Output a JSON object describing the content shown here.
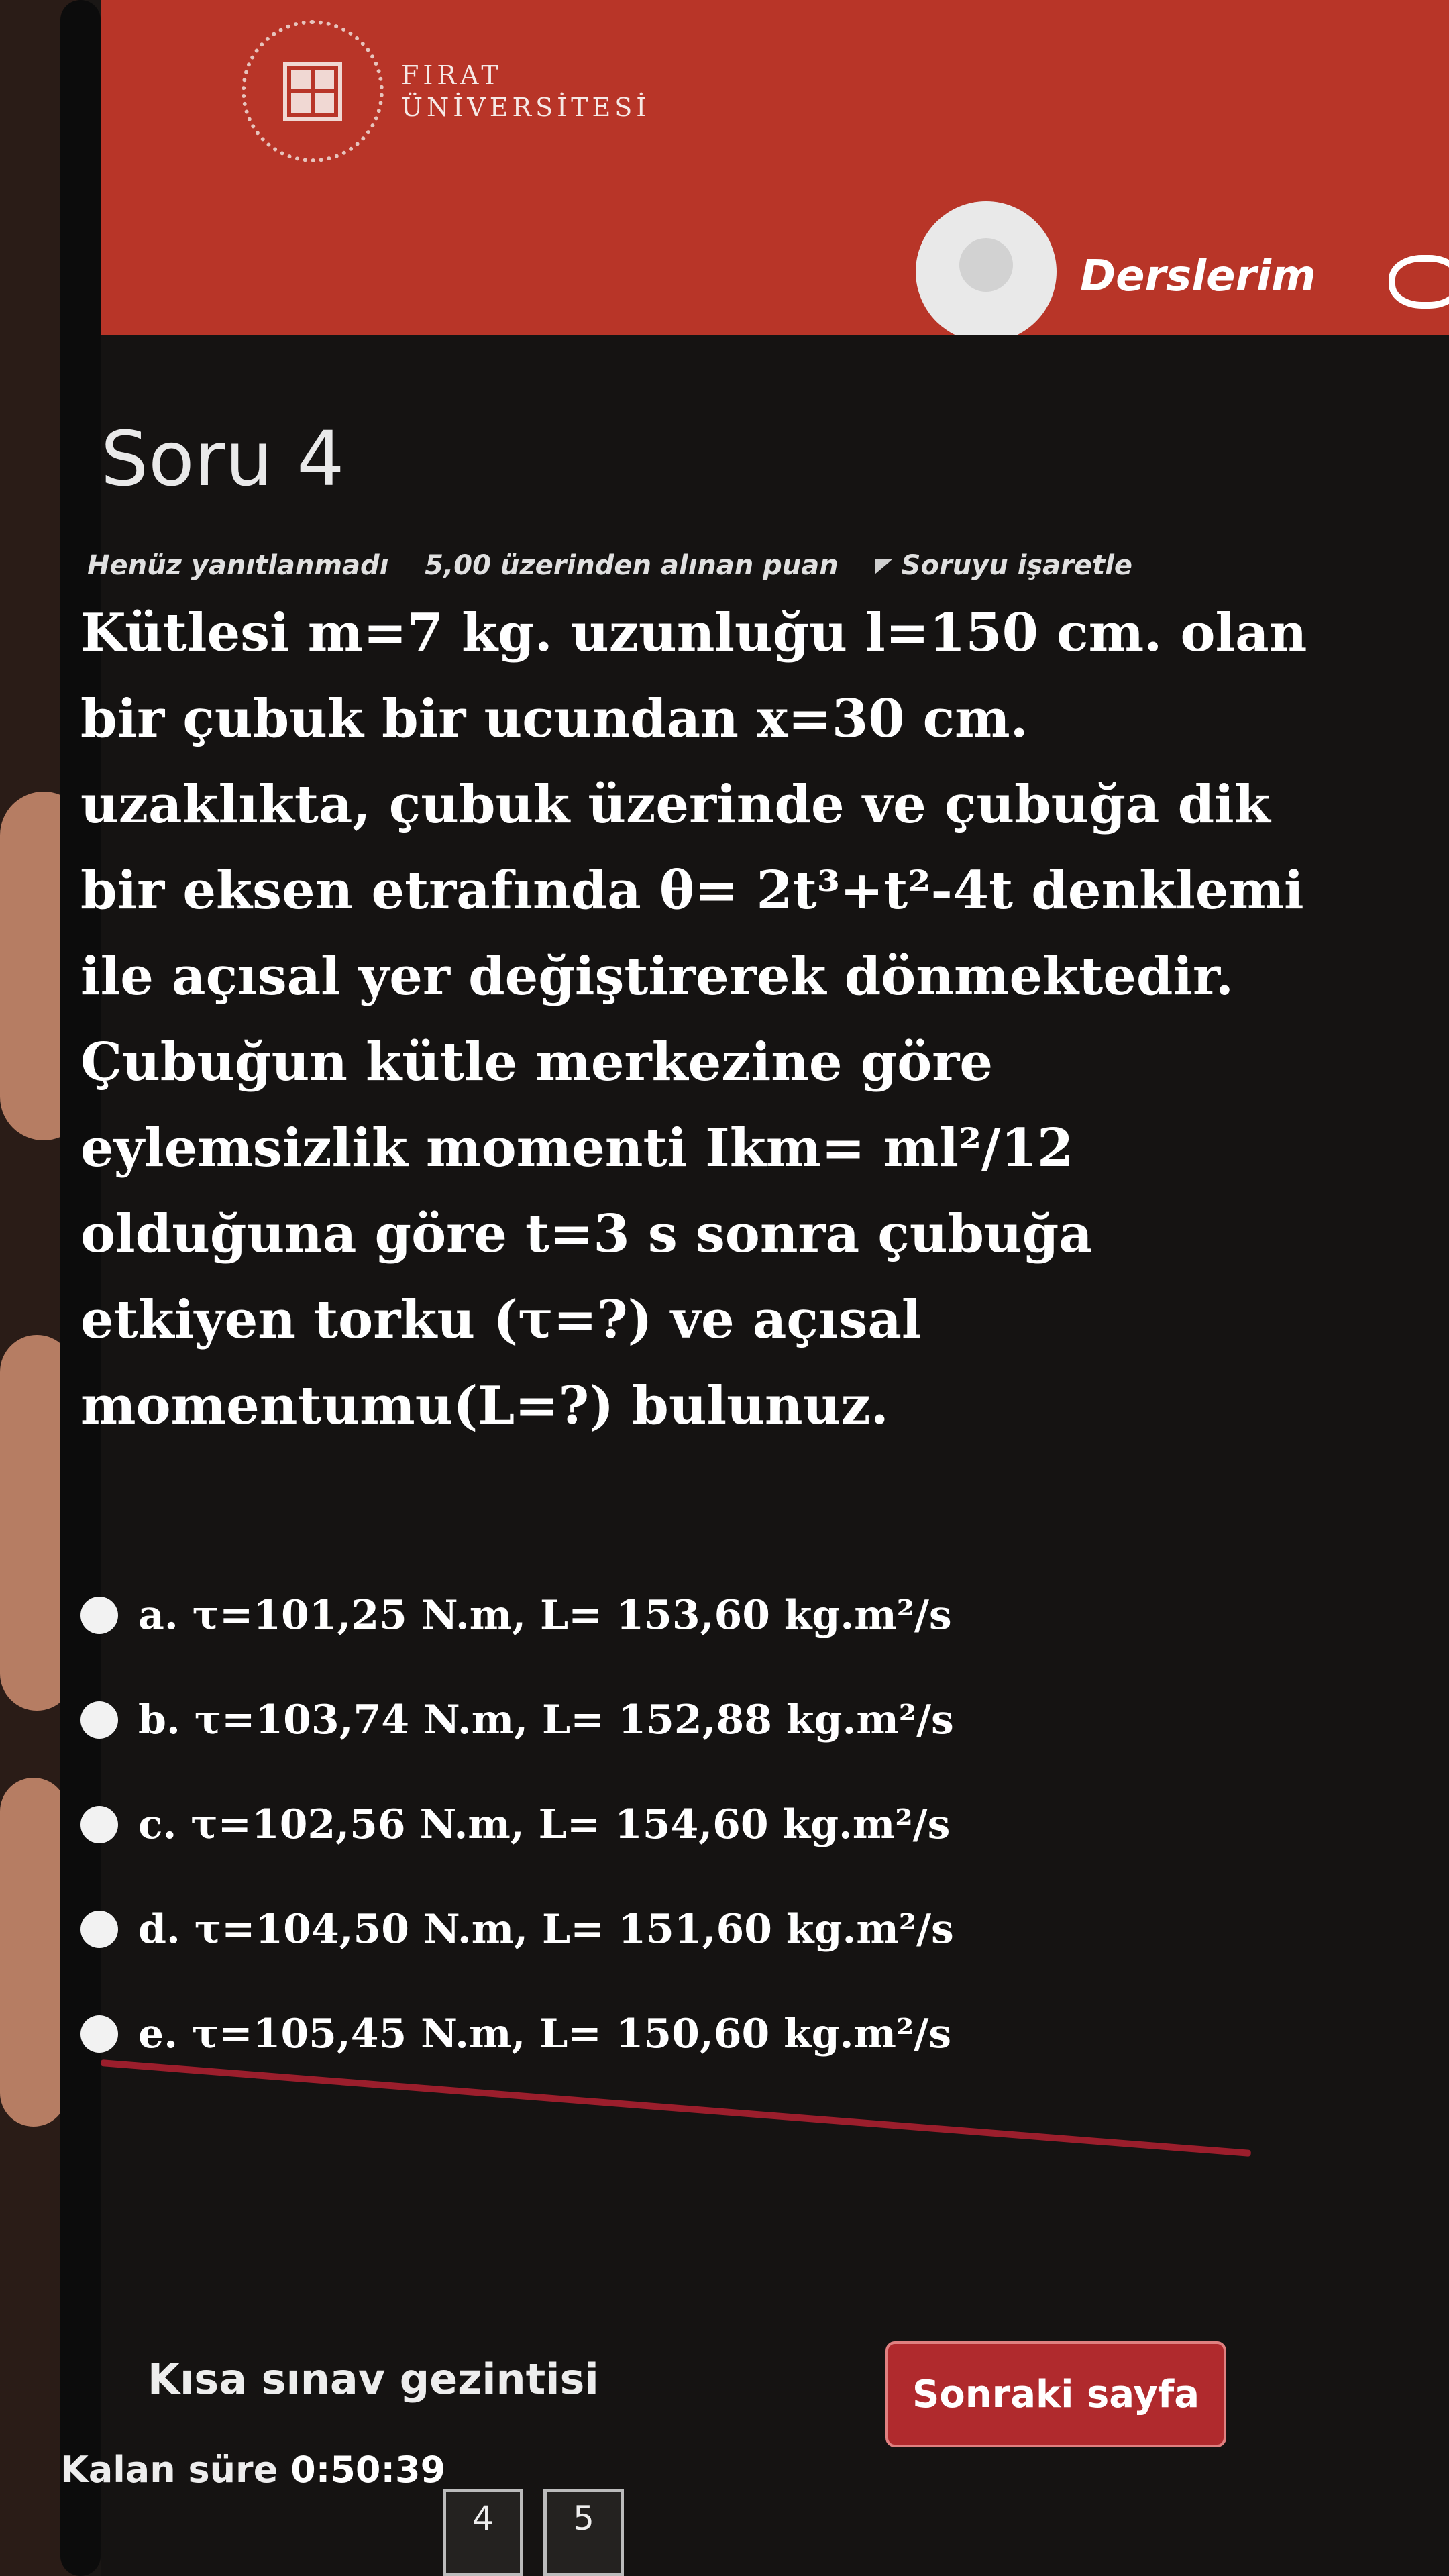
{
  "header": {
    "university": "FIRAT ÜNİVERSİTESİ",
    "nav_link": "Derslerim"
  },
  "question": {
    "title": "Soru 4",
    "status": "Henüz yanıtlanmadı",
    "points": "5,00 üzerinden alınan puan",
    "flag_label": "Soruyu işaretle",
    "text_lines": [
      "Kütlesi  m=7 kg. uzunluğu  l=150 cm.  olan",
      "bir çubuk bir ucundan  x=30 cm.",
      "uzaklıkta, çubuk üzerinde ve çubuğa dik",
      "bir eksen etrafında  θ= 2t³+t²-4t  denklemi",
      "ile açısal yer değiştirerek dönmektedir.",
      "Çubuğun kütle merkezine göre",
      "eylemsizlik momenti  Ikm= ml²/12",
      "olduğuna göre  t=3 s  sonra çubuğa",
      "etkiyen torku (τ=?) ve açısal",
      "momentumu(L=?) bulunuz."
    ],
    "options": [
      "a. τ=101,25 N.m,  L= 153,60 kg.m²/s",
      "b. τ=103,74 N.m,  L= 152,88 kg.m²/s",
      "c. τ=102,56 N.m,  L= 154,60 kg.m²/s",
      "d. τ=104,50 N.m,  L= 151,60 kg.m²/s",
      "e. τ=105,45 N.m,  L= 150,60 kg.m²/s"
    ]
  },
  "footer": {
    "next_button": "Sonraki sayfa",
    "nav_title": "Kısa sınav gezintisi",
    "time_label": "Kalan süre",
    "time_value": "0:50:39",
    "pages": [
      "4",
      "5"
    ]
  }
}
